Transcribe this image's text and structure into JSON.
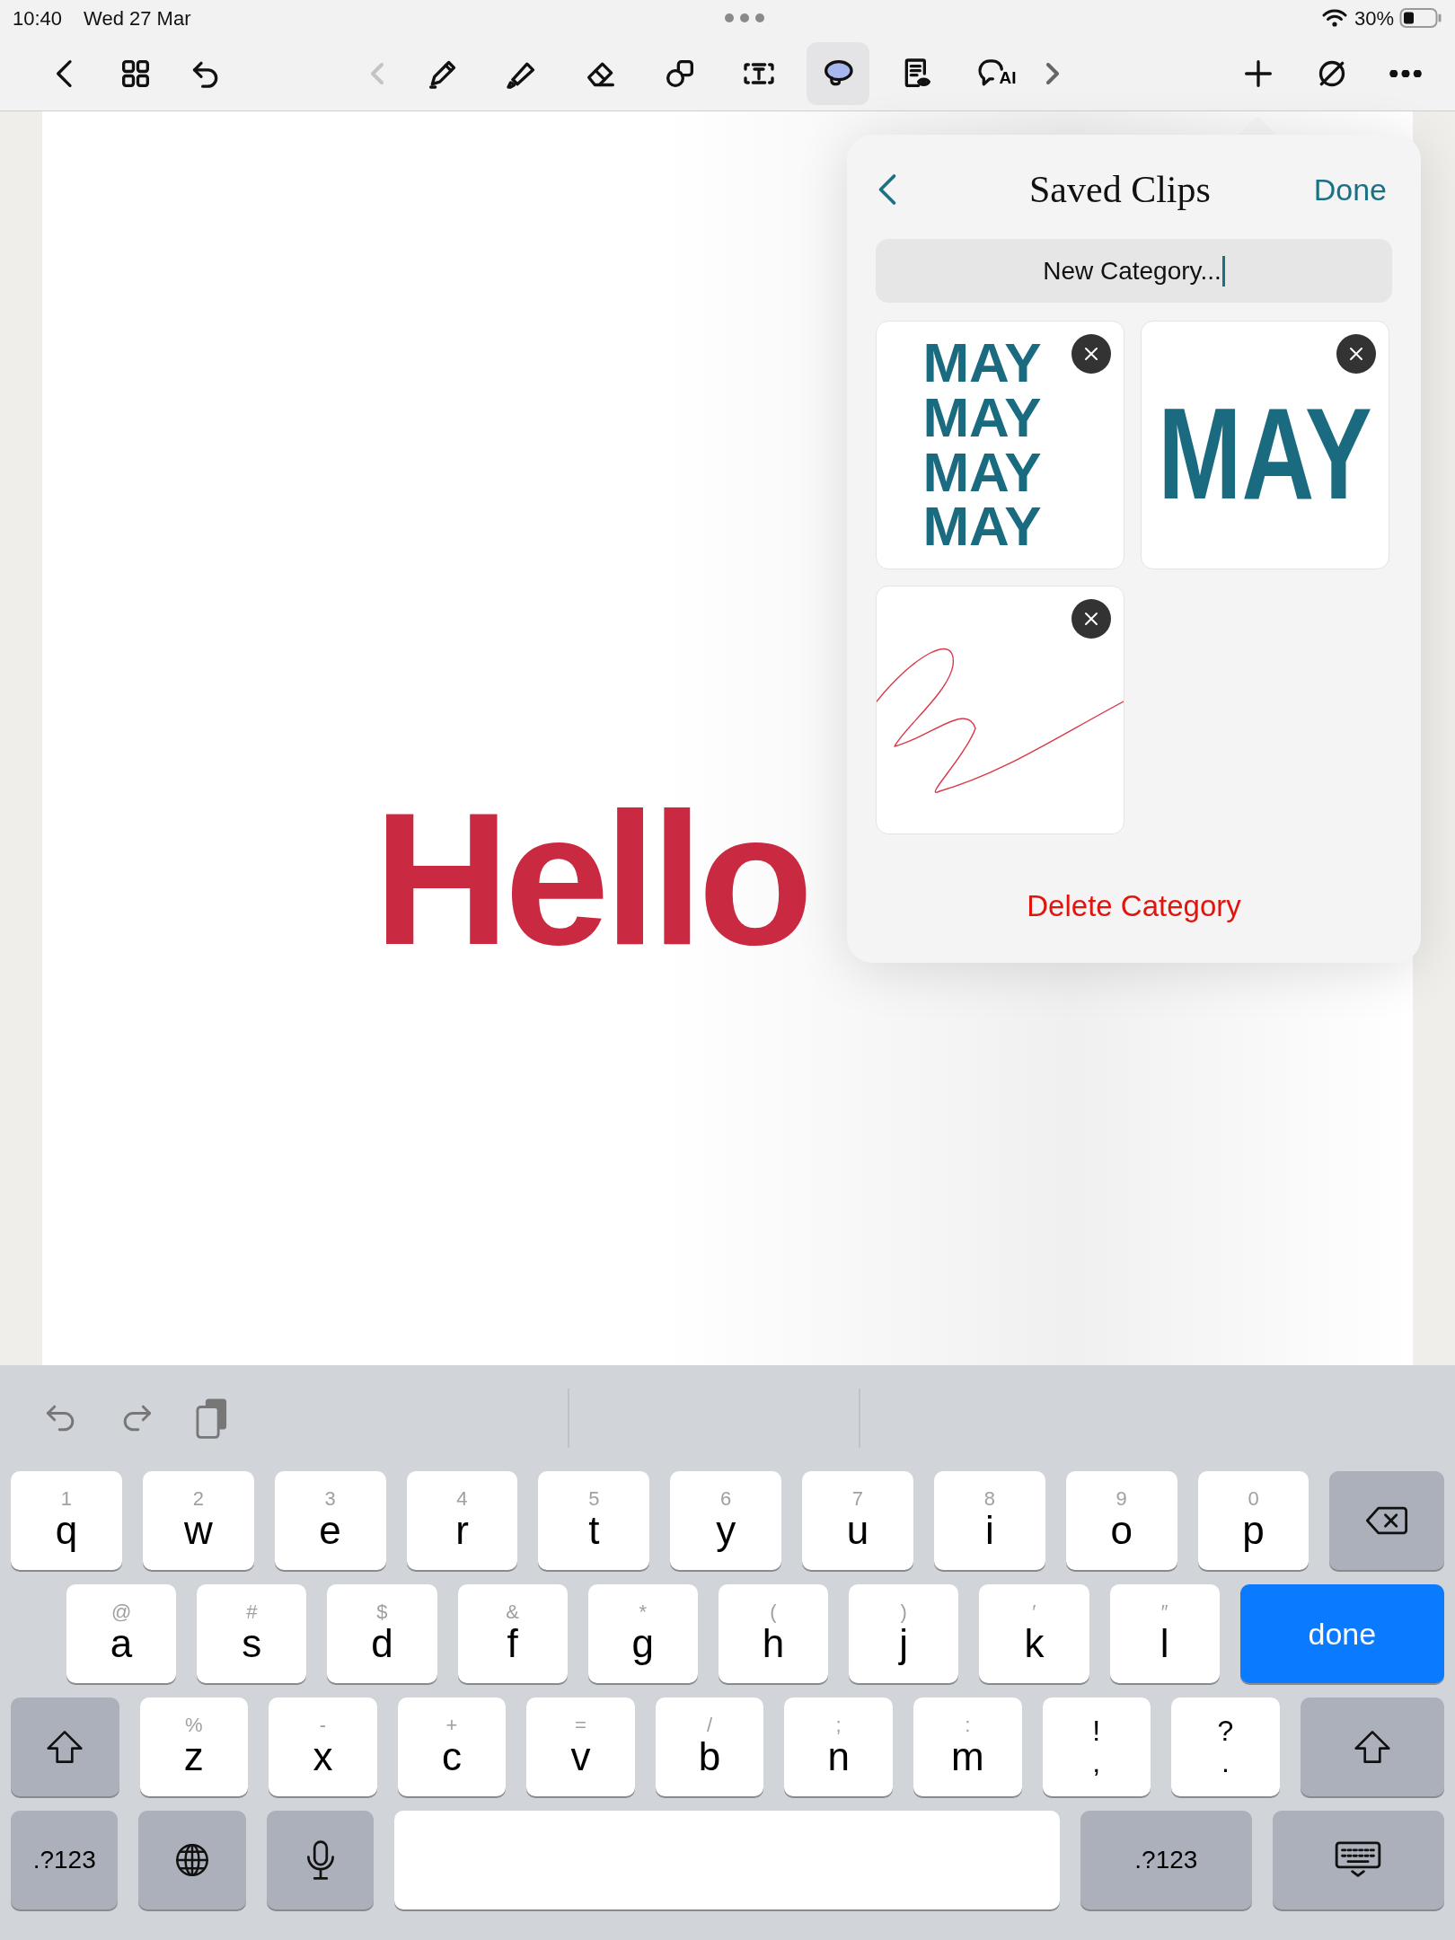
{
  "status_bar": {
    "time": "10:40",
    "date": "Wed 27 Mar",
    "battery": "30%"
  },
  "toolbar": {
    "tools": [
      {
        "kind": "pen",
        "selected": false
      },
      {
        "kind": "highlighter",
        "selected": false
      },
      {
        "kind": "eraser",
        "selected": false
      },
      {
        "kind": "shapes",
        "selected": false
      },
      {
        "kind": "textbox",
        "selected": false
      },
      {
        "kind": "lasso",
        "selected": true
      },
      {
        "kind": "document",
        "selected": false
      },
      {
        "kind": "ai",
        "label": "AI",
        "selected": false
      }
    ]
  },
  "canvas": {
    "handwriting": "Hello"
  },
  "popover": {
    "title": "Saved Clips",
    "done": "Done",
    "category_field": {
      "value": "New Category..."
    },
    "clips": [
      {
        "kind": "text",
        "lines": [
          "MAY",
          "MAY",
          "MAY",
          "MAY"
        ]
      },
      {
        "kind": "text",
        "lines": [
          "MAY"
        ]
      },
      {
        "kind": "scribble"
      }
    ],
    "delete": "Delete Category"
  },
  "keyboard": {
    "rows": [
      [
        {
          "kind": "letter",
          "label": "q",
          "hint": "1"
        },
        {
          "kind": "letter",
          "label": "w",
          "hint": "2"
        },
        {
          "kind": "letter",
          "label": "e",
          "hint": "3"
        },
        {
          "kind": "letter",
          "label": "r",
          "hint": "4"
        },
        {
          "kind": "letter",
          "label": "t",
          "hint": "5"
        },
        {
          "kind": "letter",
          "label": "y",
          "hint": "6"
        },
        {
          "kind": "letter",
          "label": "u",
          "hint": "7"
        },
        {
          "kind": "letter",
          "label": "i",
          "hint": "8"
        },
        {
          "kind": "letter",
          "label": "o",
          "hint": "9"
        },
        {
          "kind": "letter",
          "label": "p",
          "hint": "0"
        },
        {
          "kind": "backspace"
        }
      ],
      [
        {
          "kind": "letter",
          "label": "a",
          "hint": "@"
        },
        {
          "kind": "letter",
          "label": "s",
          "hint": "#"
        },
        {
          "kind": "letter",
          "label": "d",
          "hint": "$"
        },
        {
          "kind": "letter",
          "label": "f",
          "hint": "&"
        },
        {
          "kind": "letter",
          "label": "g",
          "hint": "*"
        },
        {
          "kind": "letter",
          "label": "h",
          "hint": "("
        },
        {
          "kind": "letter",
          "label": "j",
          "hint": ")"
        },
        {
          "kind": "letter",
          "label": "k",
          "hint": "′"
        },
        {
          "kind": "letter",
          "label": "l",
          "hint": "″"
        },
        {
          "kind": "action",
          "label": "done"
        }
      ],
      [
        {
          "kind": "shift"
        },
        {
          "kind": "letter",
          "label": "z",
          "hint": "%"
        },
        {
          "kind": "letter",
          "label": "x",
          "hint": "-"
        },
        {
          "kind": "letter",
          "label": "c",
          "hint": "+"
        },
        {
          "kind": "letter",
          "label": "v",
          "hint": "="
        },
        {
          "kind": "letter",
          "label": "b",
          "hint": "/"
        },
        {
          "kind": "letter",
          "label": "n",
          "hint": ";"
        },
        {
          "kind": "letter",
          "label": "m",
          "hint": ":"
        },
        {
          "kind": "punct",
          "top": "!",
          "bottom": ","
        },
        {
          "kind": "punct",
          "top": "?",
          "bottom": "."
        },
        {
          "kind": "shift"
        }
      ],
      [
        {
          "kind": "mode",
          "label": ".?123"
        },
        {
          "kind": "globe"
        },
        {
          "kind": "mic"
        },
        {
          "kind": "space"
        },
        {
          "kind": "mode",
          "label": ".?123"
        },
        {
          "kind": "hide"
        }
      ]
    ]
  }
}
